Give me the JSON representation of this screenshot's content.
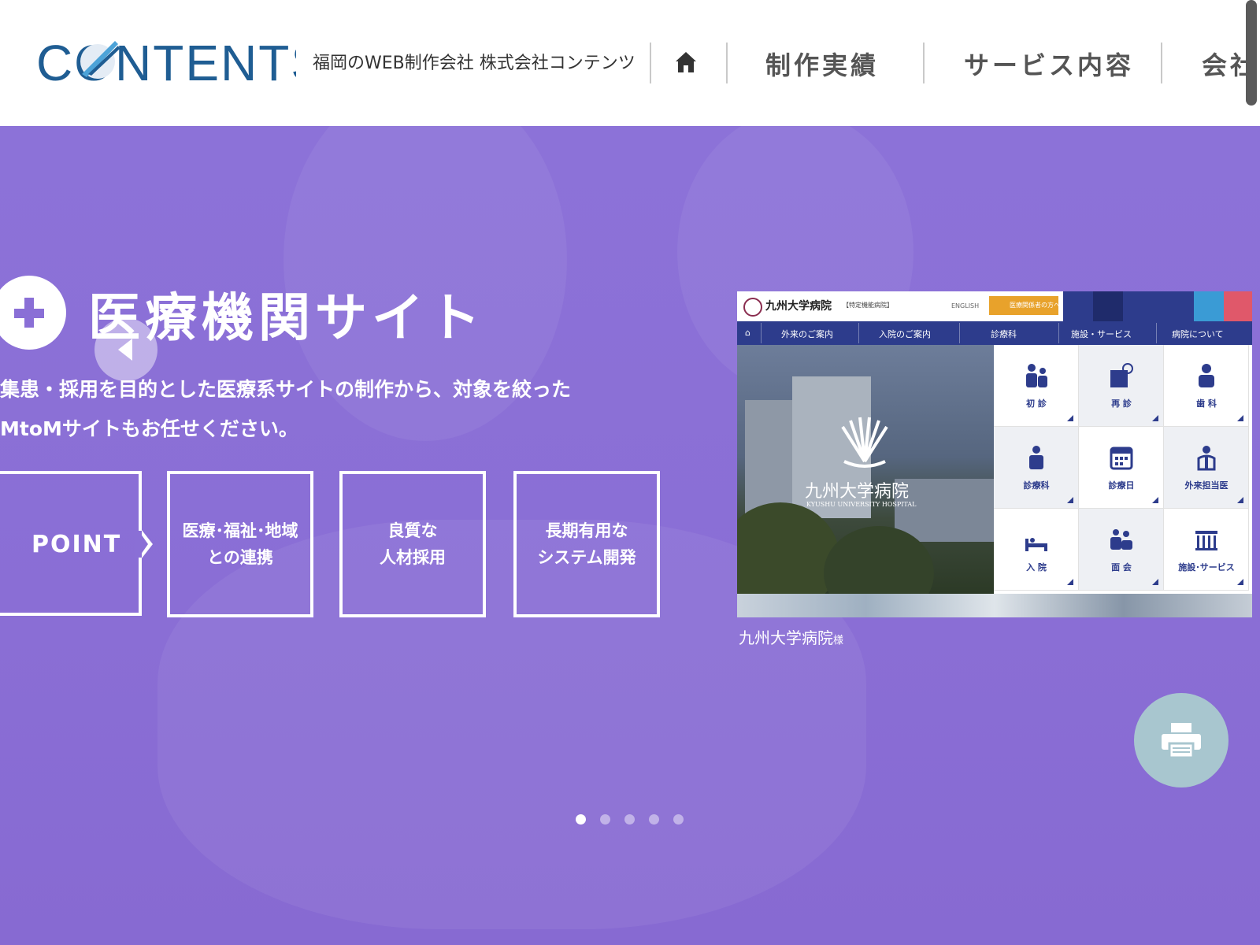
{
  "header": {
    "logo_text": "CONTENTS",
    "tagline": "福岡のWEB制作会社 株式会社コンテンツ",
    "home_icon": "home-icon",
    "nav": [
      "制作実績",
      "サービス内容",
      "会社"
    ]
  },
  "hero": {
    "title": "医療機関サイト",
    "description_line1": "集患・採用を目的とした医療系サイトの制作から、対象を絞った",
    "description_line2": "MtoMサイトもお任せください。",
    "point_label": "POINT",
    "features": [
      {
        "line1": "医療･福祉･地域",
        "line2": "との連携"
      },
      {
        "line1": "良質な",
        "line2": "人材採用"
      },
      {
        "line1": "長期有用な",
        "line2": "システム開発"
      }
    ],
    "caption": "九州大学病院",
    "caption_suffix": "様",
    "slides_total": 5,
    "active_slide": 1
  },
  "mockup": {
    "name": "九州大学病院",
    "badge": "【特定機能病院】",
    "english": "ENGLISH",
    "orange_btn": "医療関係者の方へ",
    "nav": [
      "外来のご案内",
      "入院のご案内",
      "診療科",
      "施設・サービス",
      "病院について"
    ],
    "photo_title": "九州大学病院",
    "photo_subtitle": "KYUSHU UNIVERSITY HOSPITAL",
    "tiles": [
      "初 診",
      "再 診",
      "歯 科",
      "診療科",
      "診療日",
      "外来担当医",
      "入 院",
      "面 会",
      "施設･サービス"
    ]
  },
  "colors": {
    "hero_bg": "#8a6fd6",
    "logo_blue": "#1f5d93",
    "logo_accent": "#4da3d8",
    "mockup_nav": "#2d3c8c",
    "print_button": "#a8c6cf"
  }
}
